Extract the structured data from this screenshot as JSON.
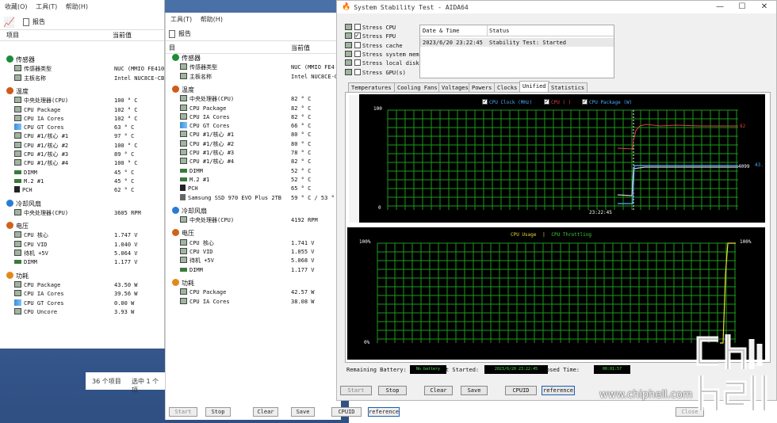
{
  "win1": {
    "menu": [
      "收藏(O)",
      "工具(T)",
      "帮助(H)"
    ],
    "toolbar_label": "报告",
    "col_item": "项目",
    "col_value": "当前值",
    "groups": [
      {
        "label": "传感器",
        "rows": [
          {
            "name": "传感器类型",
            "value": "NUC  (MMIO FE410"
          },
          {
            "name": "主板名称",
            "value": "Intel NUC8CE-CB"
          }
        ]
      },
      {
        "label": "温度",
        "rows": [
          {
            "name": "中央处理器(CPU)",
            "value": "100 ° C"
          },
          {
            "name": "CPU Package",
            "value": "102 ° C"
          },
          {
            "name": "CPU IA Cores",
            "value": "102 ° C"
          },
          {
            "name": "CPU GT Cores",
            "value": "63 ° C"
          },
          {
            "name": "CPU #1/核心 #1",
            "value": "97 ° C"
          },
          {
            "name": "CPU #1/核心 #2",
            "value": "100 ° C"
          },
          {
            "name": "CPU #1/核心 #3",
            "value": "89 ° C"
          },
          {
            "name": "CPU #1/核心 #4",
            "value": "100 ° C"
          },
          {
            "name": "DIMM",
            "value": "45 ° C"
          },
          {
            "name": "M.2 #1",
            "value": "45 ° C"
          },
          {
            "name": "PCH",
            "value": "62 ° C"
          }
        ]
      },
      {
        "label": "冷却风扇",
        "rows": [
          {
            "name": "中央处理器(CPU)",
            "value": "3605 RPM"
          }
        ]
      },
      {
        "label": "电压",
        "rows": [
          {
            "name": "CPU 核心",
            "value": "1.747 V"
          },
          {
            "name": "CPU VID",
            "value": "1.040 V"
          },
          {
            "name": "待机 +5V",
            "value": "5.064 V"
          },
          {
            "name": "DIMM",
            "value": "1.177 V"
          }
        ]
      },
      {
        "label": "功耗",
        "rows": [
          {
            "name": "CPU Package",
            "value": "43.50 W"
          },
          {
            "name": "CPU IA Cores",
            "value": "39.56 W"
          },
          {
            "name": "CPU GT Cores",
            "value": "0.00 W"
          },
          {
            "name": "CPU Uncore",
            "value": "3.93 W"
          }
        ]
      }
    ],
    "status_count": "36 个项目",
    "status_selected": "选中 1 个项"
  },
  "win2": {
    "menu": [
      "工具(T)",
      "帮助(H)"
    ],
    "toolbar_label": "报告",
    "col_item": "目",
    "col_value": "当前值",
    "groups": [
      {
        "label": "传感器",
        "rows": [
          {
            "name": "传感器类型",
            "value": "NUC  (MMIO FE4"
          },
          {
            "name": "主板名称",
            "value": "Intel NUC8CE-C"
          }
        ]
      },
      {
        "label": "温度",
        "rows": [
          {
            "name": "中央处理器(CPU)",
            "value": "82 ° C"
          },
          {
            "name": "CPU Package",
            "value": "82 ° C"
          },
          {
            "name": "CPU IA Cores",
            "value": "82 ° C"
          },
          {
            "name": "CPU GT Cores",
            "value": "66 ° C"
          },
          {
            "name": "CPU #1/核心 #1",
            "value": "80 ° C"
          },
          {
            "name": "CPU #1/核心 #2",
            "value": "80 ° C"
          },
          {
            "name": "CPU #1/核心 #3",
            "value": "78 ° C"
          },
          {
            "name": "CPU #1/核心 #4",
            "value": "82 ° C"
          },
          {
            "name": "DIMM",
            "value": "52 ° C"
          },
          {
            "name": "M.2 #1",
            "value": "52 ° C"
          },
          {
            "name": "PCH",
            "value": "65 ° C"
          },
          {
            "name": "Samsung SSD 970 EVO Plus 2TB",
            "value": "59 ° C / 53 ° C"
          }
        ]
      },
      {
        "label": "冷却风扇",
        "rows": [
          {
            "name": "中央处理器(CPU)",
            "value": "4192 RPM"
          }
        ]
      },
      {
        "label": "电压",
        "rows": [
          {
            "name": "CPU 核心",
            "value": "1.741 V"
          },
          {
            "name": "CPU VID",
            "value": "1.055 V"
          },
          {
            "name": "待机 +5V",
            "value": "5.068 V"
          },
          {
            "name": "DIMM",
            "value": "1.177 V"
          }
        ]
      },
      {
        "label": "功耗",
        "rows": [
          {
            "name": "CPU Package",
            "value": "42.57 W"
          },
          {
            "name": "CPU IA Cores",
            "value": "38.08 W"
          }
        ]
      }
    ],
    "buttons": [
      "Start",
      "Stop",
      "Clear",
      "Save",
      "CPUID",
      "reference"
    ],
    "close_label": "Close"
  },
  "aida": {
    "title": "System Stability Test - AIDA64",
    "window_controls": [
      "—",
      "☐",
      "✕"
    ],
    "stress": [
      {
        "label": "Stress CPU",
        "checked": false
      },
      {
        "label": "Stress FPU",
        "checked": true
      },
      {
        "label": "Stress cache",
        "checked": false
      },
      {
        "label": "Stress system mem",
        "checked": false
      },
      {
        "label": "Stress local disk",
        "checked": false
      },
      {
        "label": "Stress GPU(s)",
        "checked": false
      }
    ],
    "log_headers": [
      "Date & Time",
      "Status"
    ],
    "log_rows": [
      {
        "time": "2023/6/20 23:22:45",
        "status": "Stability Test: Started"
      }
    ],
    "tabs": [
      "Temperatures",
      "Cooling Fans",
      "Voltages",
      "Powers",
      "Clocks",
      "Unified",
      "Statistics"
    ],
    "active_tab": "Unified",
    "graph1": {
      "legend": [
        "CPU Clock (MHz)",
        "CPU ( )",
        "CPU Package (W)"
      ],
      "y_top": "100",
      "y_bottom": "0",
      "time_label": "23:22:45",
      "right_labels": [
        "82",
        "4099",
        "43."
      ]
    },
    "graph2": {
      "title": "CPU Usage",
      "sep": "|",
      "title2": "CPU Throttling",
      "y_top": "100%",
      "y_bottom": "0%",
      "right_label": "100%"
    },
    "battery_label": "Remaining Battery:",
    "battery_value": "No battery",
    "started_label": "t Started:",
    "started_value": "2023/6/20 23:22:45",
    "elapsed_label": "psed Time:",
    "elapsed_value": "00:01:57",
    "buttons": [
      "Start",
      "Stop",
      "Clear",
      "Save",
      "CPUID",
      "reference"
    ]
  },
  "watermark": {
    "logo_text": "chip hell",
    "url": "www.chiphell.com"
  },
  "colors": {
    "grid_green": "#1b9a1b",
    "clock_line": "#4a90e2",
    "temp_line": "#e04040",
    "power_line": "#5ab0ff",
    "usage_line": "#f0e030",
    "legend_blue": "#4aa8ff",
    "legend_yellow": "#e8d830",
    "legend_green": "#3ad03a"
  }
}
